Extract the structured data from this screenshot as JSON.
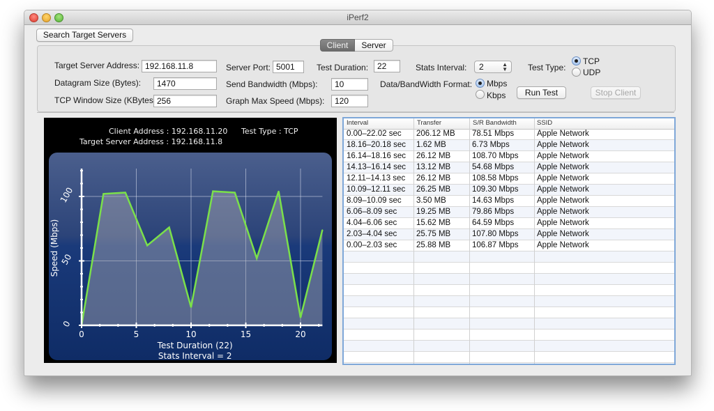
{
  "window": {
    "title": "iPerf2"
  },
  "toolbar": {
    "search_servers_label": "Search Target Servers"
  },
  "tabs": [
    {
      "label": "Client",
      "selected": true
    },
    {
      "label": "Server",
      "selected": false
    }
  ],
  "form": {
    "target_server_address": {
      "label": "Target Server Address:",
      "value": "192.168.11.8"
    },
    "datagram_size": {
      "label": "Datagram Size (Bytes):",
      "value": "1470"
    },
    "tcp_window_size": {
      "label": "TCP Window Size (KBytes):",
      "value": "256"
    },
    "server_port": {
      "label": "Server Port:",
      "value": "5001"
    },
    "send_bandwidth": {
      "label": "Send Bandwidth (Mbps):",
      "value": "10"
    },
    "graph_max_speed": {
      "label": "Graph Max Speed (Mbps):",
      "value": "120"
    },
    "test_duration": {
      "label": "Test Duration:",
      "value": "22"
    },
    "stats_interval": {
      "label": "Stats Interval:",
      "value": "2"
    },
    "format": {
      "label": "Data/BandWidth Format:",
      "options": [
        "Mbps",
        "Kbps"
      ],
      "selected": "Mbps"
    },
    "test_type": {
      "label": "Test Type:",
      "options": [
        "TCP",
        "UDP"
      ],
      "selected": "TCP"
    },
    "run_test_label": "Run Test",
    "stop_client_label": "Stop Client"
  },
  "chart_header": {
    "client_address": "Client Address : 192.168.11.20",
    "test_type": "Test Type : TCP",
    "target_server": "Target Server Address : 192.168.11.8"
  },
  "chart_data": {
    "type": "area",
    "title": "",
    "xlabel": "Test Duration (22)",
    "xlabel2": "Stats Interval = 2",
    "ylabel": "Speed (Mbps)",
    "x": [
      0,
      2,
      4,
      6,
      8,
      10,
      12,
      14,
      16,
      18,
      20,
      22
    ],
    "series": [
      {
        "name": "Speed",
        "values": [
          0,
          102,
          103,
          62,
          76,
          14,
          104,
          103,
          52,
          104,
          6,
          74
        ]
      }
    ],
    "xlim": [
      0,
      22
    ],
    "ylim": [
      0,
      120
    ],
    "xticks": [
      0,
      5,
      10,
      15,
      20
    ],
    "yticks": [
      0,
      50,
      100
    ],
    "grid": true,
    "line_color": "#7be04a"
  },
  "table": {
    "columns": [
      "Interval",
      "Transfer",
      "S/R Bandwidth",
      "SSID"
    ],
    "rows": [
      [
        "0.00–22.02 sec",
        "206.12 MB",
        "78.51 Mbps",
        "Apple Network"
      ],
      [
        "18.16–20.18 sec",
        "1.62 MB",
        "6.73 Mbps",
        "Apple Network"
      ],
      [
        "16.14–18.16 sec",
        "26.12 MB",
        "108.70 Mbps",
        "Apple Network"
      ],
      [
        "14.13–16.14 sec",
        "13.12 MB",
        "54.68 Mbps",
        "Apple Network"
      ],
      [
        "12.11–14.13 sec",
        "26.12 MB",
        "108.58 Mbps",
        "Apple Network"
      ],
      [
        "10.09–12.11 sec",
        "26.25 MB",
        "109.30 Mbps",
        "Apple Network"
      ],
      [
        "8.09–10.09 sec",
        "3.50 MB",
        "14.63 Mbps",
        "Apple Network"
      ],
      [
        "6.06–8.09 sec",
        "19.25 MB",
        "79.86 Mbps",
        "Apple Network"
      ],
      [
        "4.04–6.06 sec",
        "15.62 MB",
        "64.59 Mbps",
        "Apple Network"
      ],
      [
        "2.03–4.04 sec",
        "25.75 MB",
        "107.80 Mbps",
        "Apple Network"
      ],
      [
        "0.00–2.03 sec",
        "25.88 MB",
        "106.87 Mbps",
        "Apple Network"
      ]
    ]
  }
}
